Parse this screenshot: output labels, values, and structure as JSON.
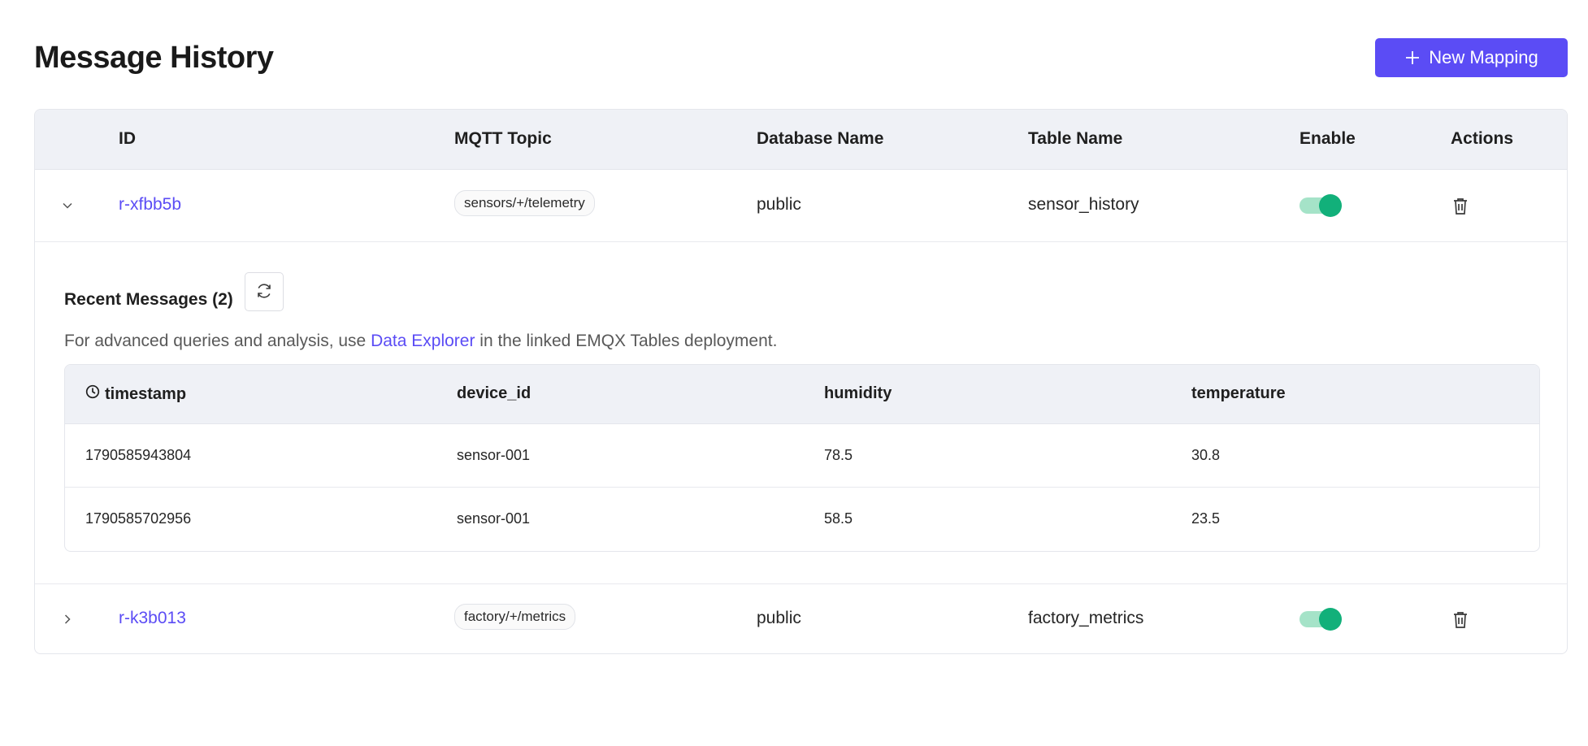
{
  "page": {
    "title": "Message History",
    "new_button_label": "New Mapping"
  },
  "colors": {
    "accent": "#5b4cf5",
    "toggle_on": "#12b07a",
    "header_bg": "#eff1f6"
  },
  "table": {
    "headers": {
      "id": "ID",
      "topic": "MQTT Topic",
      "database": "Database Name",
      "table": "Table Name",
      "enable": "Enable",
      "actions": "Actions"
    },
    "rows": [
      {
        "id": "r-xfbb5b",
        "topic": "sensors/+/telemetry",
        "database": "public",
        "table": "sensor_history",
        "enabled": true,
        "expanded": true
      },
      {
        "id": "r-k3b013",
        "topic": "factory/+/metrics",
        "database": "public",
        "table": "factory_metrics",
        "enabled": true,
        "expanded": false
      }
    ]
  },
  "recent": {
    "title": "Recent Messages (2)",
    "info_prefix": "For advanced queries and analysis, use ",
    "info_link": "Data Explorer",
    "info_suffix": " in the linked EMQX Tables deployment.",
    "columns": {
      "timestamp": "timestamp",
      "device_id": "device_id",
      "humidity": "humidity",
      "temperature": "temperature"
    },
    "rows": [
      {
        "timestamp": "1790585943804",
        "device_id": "sensor-001",
        "humidity": "78.5",
        "temperature": "30.8"
      },
      {
        "timestamp": "1790585702956",
        "device_id": "sensor-001",
        "humidity": "58.5",
        "temperature": "23.5"
      }
    ]
  }
}
